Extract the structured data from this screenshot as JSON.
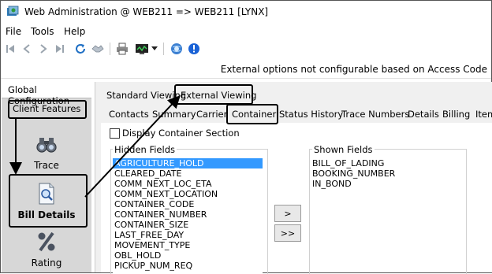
{
  "window": {
    "title": "Web Administration @ WEB211 => WEB211 [LYNX]"
  },
  "menu": [
    "File",
    "Tools",
    "Help"
  ],
  "toolbar_icons": [
    "first-record-icon",
    "previous-record-icon",
    "next-record-icon",
    "last-record-icon",
    "refresh-icon",
    "handshake-icon",
    "print-icon",
    "monitor-icon",
    "dropdown-arrow-icon",
    "globe-icon",
    "info-icon"
  ],
  "notice": "External options not configurable based on Access Code",
  "left_panel": {
    "tab": "Global Configuration",
    "client_features": "Client Features",
    "items": [
      {
        "label": "Trace",
        "icon": "binoculars-icon"
      },
      {
        "label": "Bill Details",
        "icon": "document-search-icon"
      },
      {
        "label": "Rating",
        "icon": "percent-icon"
      }
    ]
  },
  "viewing_tabs": [
    "Standard Viewing",
    "External Viewing"
  ],
  "feature_tabs": [
    "Contacts",
    "Summary",
    "Carrier",
    "Container",
    "Status History",
    "Trace Numbers",
    "Details",
    "Billing",
    "Item"
  ],
  "container": {
    "checkbox_label": "Display Container Section",
    "checked": false,
    "hidden_label": "Hidden Fields",
    "shown_label": "Shown Fields",
    "hidden_fields": [
      "AGRICULTURE_HOLD",
      "CLEARED_DATE",
      "COMM_NEXT_LOC_ETA",
      "COMM_NEXT_LOCATION",
      "CONTAINER_CODE",
      "CONTAINER_NUMBER",
      "CONTAINER_SIZE",
      "LAST_FREE_DAY",
      "MOVEMENT_TYPE",
      "OBL_HOLD",
      "PICKUP_NUM_REQ"
    ],
    "shown_fields": [
      "BILL_OF_LADING",
      "BOOKING_NUMBER",
      "IN_BOND"
    ],
    "move_one": ">",
    "move_all": ">>"
  },
  "colors": {
    "selection": "#3399ff",
    "nav_background": "#d7d7d7"
  }
}
